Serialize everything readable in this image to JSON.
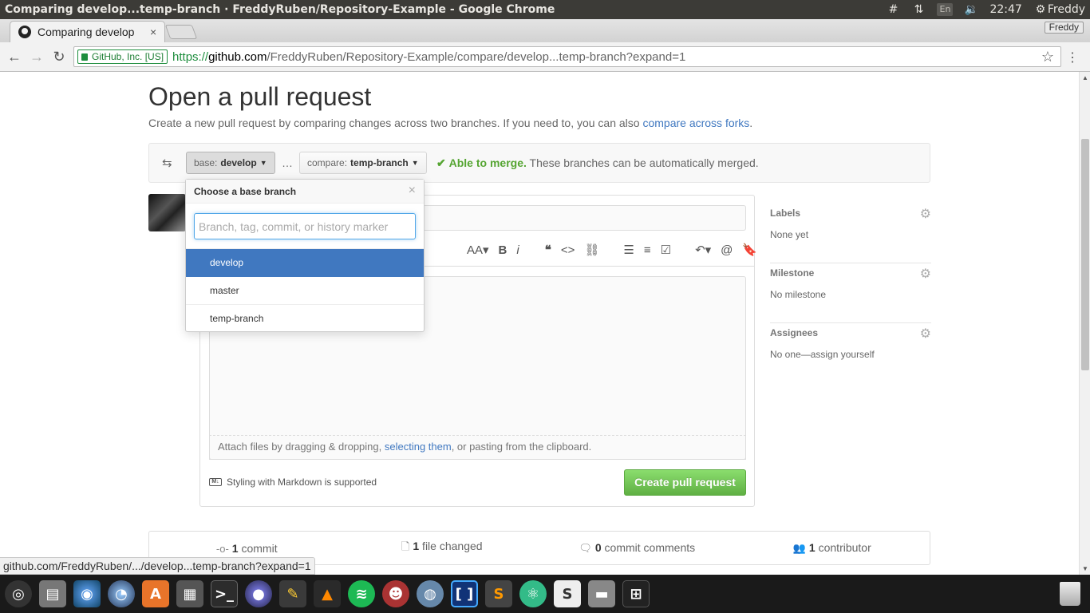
{
  "os": {
    "window_title": "Comparing develop...temp-branch · FreddyRuben/Repository-Example - Google Chrome",
    "clock": "22:47",
    "keyboard_layout": "En",
    "user": "Freddy"
  },
  "browser": {
    "tab_title": "Comparing develop",
    "tab_close": "×",
    "profile": "Freddy",
    "ev_cert": "GitHub, Inc. [US]",
    "url_scheme": "https://",
    "url_host": "github.com",
    "url_path": "/FreddyRuben/Repository-Example/compare/develop...temp-branch?expand=1",
    "status_url": "github.com/FreddyRuben/.../develop...temp-branch?expand=1"
  },
  "page": {
    "title": "Open a pull request",
    "subtitle_text": "Create a new pull request by comparing changes across two branches. If you need to, you can also ",
    "subtitle_link": "compare across forks",
    "subtitle_end": "."
  },
  "compare": {
    "base_prefix": "base:",
    "base_branch": "develop",
    "ellipsis": "…",
    "compare_prefix": "compare:",
    "compare_branch": "temp-branch",
    "merge_ok": "Able to merge.",
    "merge_note": " These branches can be automatically merged."
  },
  "dropdown": {
    "header": "Choose a base branch",
    "close": "×",
    "filter_placeholder": "Branch, tag, commit, or history marker",
    "items": [
      "develop",
      "master",
      "temp-branch"
    ],
    "selected": "develop"
  },
  "editor": {
    "attach_text_1": "Attach files by dragging & dropping, ",
    "attach_link": "selecting them",
    "attach_text_2": ", or pasting from the clipboard.",
    "markdown_note": "Styling with Markdown is supported",
    "submit": "Create pull request"
  },
  "sidebar": {
    "sections": [
      {
        "heading": "Labels",
        "value": "None yet"
      },
      {
        "heading": "Milestone",
        "value": "No milestone"
      },
      {
        "heading": "Assignees",
        "value": "No one—assign yourself"
      }
    ]
  },
  "summary": {
    "commits_count": "1",
    "commits_label": " commit",
    "files_count": "1",
    "files_label": " file changed",
    "comments_count": "0",
    "comments_label": " commit comments",
    "contributors_count": "1",
    "contributors_label": " contributor"
  },
  "colors": {
    "link": "#4078c0",
    "success": "#55a532",
    "button_green": "#60b044",
    "dropdown_active": "#4078c0"
  },
  "dock_apps": [
    "ubuntu-dash",
    "files",
    "chromium",
    "firefox",
    "software-center",
    "photo-editor",
    "terminal",
    "eclipse",
    "cleaner",
    "vlc",
    "spotify",
    "sim-game",
    "network-tool",
    "bracket-editor",
    "sublime-text",
    "atom",
    "slack",
    "disk",
    "workspaces"
  ]
}
